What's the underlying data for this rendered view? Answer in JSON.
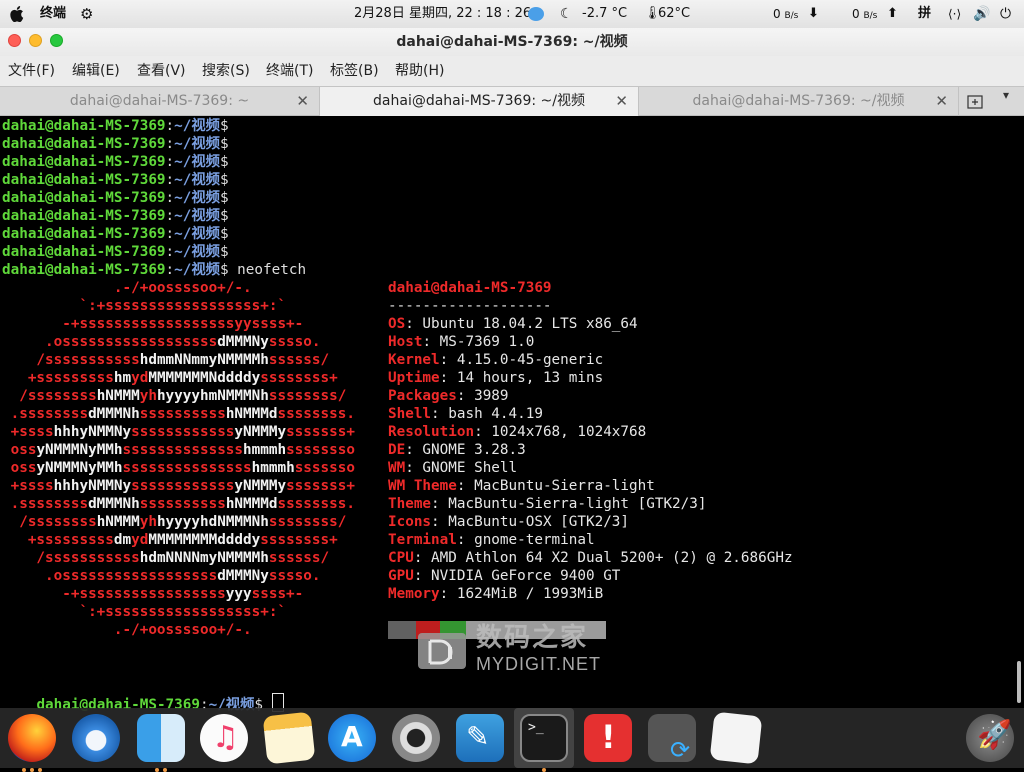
{
  "topbar": {
    "activities": "终端",
    "datetime": "2月28日 星期四, 22 : 18 : 26",
    "weather": "-2.7 °C",
    "cpu_temp": "62°C",
    "net_down_value": "0",
    "net_down_unit": "B/s",
    "net_up_value": "0",
    "net_up_unit": "B/s",
    "input_method": "拼",
    "network_icon": "⟨·⟩"
  },
  "window": {
    "title": "dahai@dahai-MS-7369: ~/视频"
  },
  "menu": [
    "文件(F)",
    "编辑(E)",
    "查看(V)",
    "搜索(S)",
    "终端(T)",
    "标签(B)",
    "帮助(H)"
  ],
  "tabs": [
    {
      "label": "dahai@dahai-MS-7369: ~"
    },
    {
      "label": "dahai@dahai-MS-7369: ~/视频"
    },
    {
      "label": "dahai@dahai-MS-7369: ~/视频"
    }
  ],
  "terminal": {
    "prompt_user": "dahai@dahai-MS-7369",
    "prompt_sep": ":",
    "prompt_path": "~/视频",
    "prompt_char": "$",
    "command": " neofetch",
    "info_header": "dahai@dahai-MS-7369",
    "info_rule": "-------------------",
    "info": [
      {
        "key": "OS",
        "value": " Ubuntu 18.04.2 LTS x86_64"
      },
      {
        "key": "Host",
        "value": " MS-7369 1.0"
      },
      {
        "key": "Kernel",
        "value": " 4.15.0-45-generic"
      },
      {
        "key": "Uptime",
        "value": " 14 hours, 13 mins"
      },
      {
        "key": "Packages",
        "value": " 3989"
      },
      {
        "key": "Shell",
        "value": " bash 4.4.19"
      },
      {
        "key": "Resolution",
        "value": " 1024x768, 1024x768"
      },
      {
        "key": "DE",
        "value": " GNOME 3.28.3"
      },
      {
        "key": "WM",
        "value": " GNOME Shell"
      },
      {
        "key": "WM Theme",
        "value": " MacBuntu-Sierra-light"
      },
      {
        "key": "Theme",
        "value": " MacBuntu-Sierra-light [GTK2/3]"
      },
      {
        "key": "Icons",
        "value": " MacBuntu-OSX [GTK2/3]"
      },
      {
        "key": "Terminal",
        "value": " gnome-terminal"
      },
      {
        "key": "CPU",
        "value": " AMD Athlon 64 X2 Dual 5200+ (2) @ 2.686GHz"
      },
      {
        "key": "GPU",
        "value": " NVIDIA GeForce 9400 GT"
      },
      {
        "key": "Memory",
        "value": " 1624MiB / 1993MiB"
      }
    ],
    "logo": [
      [
        [
          "r",
          "             .-/+oossssoo+/-."
        ]
      ],
      [
        [
          "r",
          "         `:+ssssssssssssssssss+:`"
        ]
      ],
      [
        [
          "r",
          "       -+ssssssssssssssssssyyssss+-"
        ]
      ],
      [
        [
          "r",
          "     .ossssssssssssssssss"
        ],
        [
          "w",
          "dMMMNy"
        ],
        [
          "r",
          "sssso."
        ]
      ],
      [
        [
          "r",
          "    /sssssssssss"
        ],
        [
          "w",
          "hdmmNNmmyNMMMMh"
        ],
        [
          "r",
          "ssssss/"
        ]
      ],
      [
        [
          "r",
          "   +sssssssss"
        ],
        [
          "w",
          "hm"
        ],
        [
          "r",
          "yd"
        ],
        [
          "w",
          "MMMMMMMNddddy"
        ],
        [
          "r",
          "ssssssss+"
        ]
      ],
      [
        [
          "r",
          "  /ssssssss"
        ],
        [
          "w",
          "hNMMM"
        ],
        [
          "r",
          "yh"
        ],
        [
          "w",
          "hyyyyhmNMMMNh"
        ],
        [
          "r",
          "ssssssss/"
        ]
      ],
      [
        [
          "r",
          " .ssssssss"
        ],
        [
          "w",
          "dMMMNh"
        ],
        [
          "r",
          "ssssssssss"
        ],
        [
          "w",
          "hNMMMd"
        ],
        [
          "r",
          "ssssssss."
        ]
      ],
      [
        [
          "r",
          " +ssss"
        ],
        [
          "w",
          "hhhyNMMNy"
        ],
        [
          "r",
          "ssssssssssss"
        ],
        [
          "w",
          "yNMMMy"
        ],
        [
          "r",
          "sssssss+"
        ]
      ],
      [
        [
          "r",
          " oss"
        ],
        [
          "w",
          "yNMMMNyMMh"
        ],
        [
          "r",
          "ssssssssssssss"
        ],
        [
          "w",
          "hmmmh"
        ],
        [
          "r",
          "ssssssso"
        ]
      ],
      [
        [
          "r",
          " oss"
        ],
        [
          "w",
          "yNMMMNyMMh"
        ],
        [
          "r",
          "sssssssssssssss"
        ],
        [
          "w",
          "hmmmh"
        ],
        [
          "r",
          "sssssso"
        ]
      ],
      [
        [
          "r",
          " +ssss"
        ],
        [
          "w",
          "hhhyNMMNy"
        ],
        [
          "r",
          "ssssssssssss"
        ],
        [
          "w",
          "yNMMMy"
        ],
        [
          "r",
          "sssssss+"
        ]
      ],
      [
        [
          "r",
          " .ssssssss"
        ],
        [
          "w",
          "dMMMNh"
        ],
        [
          "r",
          "ssssssssss"
        ],
        [
          "w",
          "hNMMMd"
        ],
        [
          "r",
          "ssssssss."
        ]
      ],
      [
        [
          "r",
          "  /ssssssss"
        ],
        [
          "w",
          "hNMMM"
        ],
        [
          "r",
          "yh"
        ],
        [
          "w",
          "hyyyyhdNMMMNh"
        ],
        [
          "r",
          "ssssssss/"
        ]
      ],
      [
        [
          "r",
          "   +sssssssss"
        ],
        [
          "w",
          "dm"
        ],
        [
          "r",
          "yd"
        ],
        [
          "w",
          "MMMMMMMMddddy"
        ],
        [
          "r",
          "ssssssss+"
        ]
      ],
      [
        [
          "r",
          "    /sssssssssss"
        ],
        [
          "w",
          "hdmNNNNmyNMMMMh"
        ],
        [
          "r",
          "ssssss/"
        ]
      ],
      [
        [
          "r",
          "     .ossssssssssssssssss"
        ],
        [
          "w",
          "dMMMNy"
        ],
        [
          "r",
          "sssso."
        ]
      ],
      [
        [
          "r",
          "       -+sssssssssssssssss"
        ],
        [
          "w",
          "yyy"
        ],
        [
          "r",
          "ssss+-"
        ]
      ],
      [
        [
          "r",
          "         `:+ssssssssssssssssss+:`"
        ]
      ],
      [
        [
          "r",
          "             .-/+oossssoo+/-."
        ]
      ]
    ]
  },
  "watermark": {
    "cn": "数码之家",
    "en": "MYDIGIT.NET"
  },
  "colors": {
    "prompt_user": "#5fd83a",
    "prompt_path": "#7a9fe0",
    "logo_red": "#ee2a2a",
    "dock_bg": "#282828",
    "close": "#fe5f57",
    "minimize": "#febc2e",
    "maximize": "#28c840"
  },
  "dock": [
    {
      "icon": "firefox-icon"
    },
    {
      "icon": "thunderbird-icon"
    },
    {
      "icon": "finder-icon"
    },
    {
      "icon": "music-icon"
    },
    {
      "icon": "notes-icon"
    },
    {
      "icon": "app-store-icon"
    },
    {
      "icon": "help-icon"
    },
    {
      "icon": "mysql-workbench-icon"
    },
    {
      "icon": "terminal-icon"
    },
    {
      "icon": "error-report-icon"
    },
    {
      "icon": "video-converter-icon"
    },
    {
      "icon": "text-editor-icon"
    },
    {
      "icon": "launcher-rocket-icon"
    }
  ]
}
